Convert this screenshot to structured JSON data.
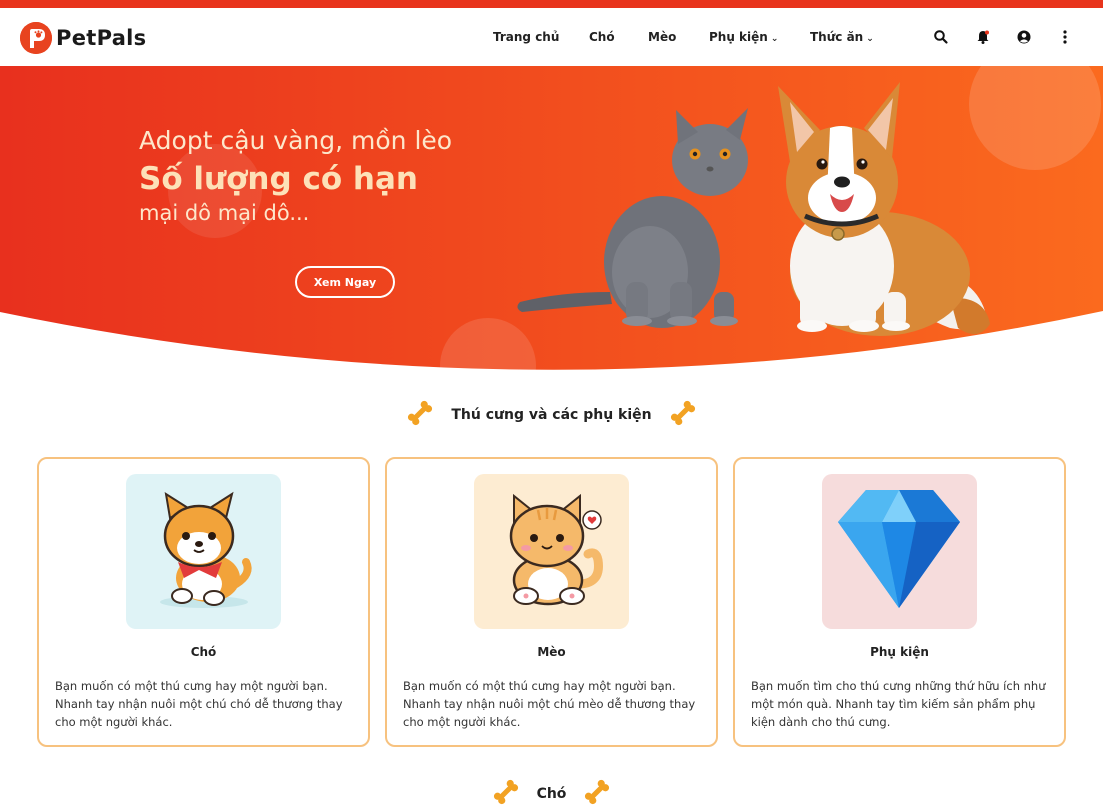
{
  "brand": {
    "name": "PetPals",
    "accent": "#e8341c",
    "hero_gradient": [
      "#e8301e",
      "#fb6a1e"
    ]
  },
  "nav": {
    "items": [
      {
        "label": "Trang chủ",
        "dropdown": false
      },
      {
        "label": "Chó",
        "dropdown": false
      },
      {
        "label": "Mèo",
        "dropdown": false
      },
      {
        "label": "Phụ kiện",
        "dropdown": true
      },
      {
        "label": "Thức ăn",
        "dropdown": true
      }
    ],
    "icons": [
      "search-icon",
      "bell-icon",
      "user-icon",
      "more-vertical-icon"
    ]
  },
  "hero": {
    "line1": "Adopt cậu vàng, mồn lèo",
    "line2": "Số lượng có hạn",
    "line3": "mại dô mại dô...",
    "button": "Xem Ngay"
  },
  "section_categories": {
    "title": "Thú cưng và các phụ kiện",
    "icon": "bone-icon"
  },
  "cards": [
    {
      "title": "Chó",
      "image": "dog-illustration",
      "bg": "#dff3f6",
      "description": "Bạn muốn có một thú cưng hay một người bạn. Nhanh tay nhận nuôi một chú chó dễ thương thay cho một người khác."
    },
    {
      "title": "Mèo",
      "image": "cat-illustration",
      "bg": "#fdecd2",
      "description": "Bạn muốn có một thú cưng hay một người bạn. Nhanh tay nhận nuôi một chú mèo dễ thương thay cho một người khác."
    },
    {
      "title": "Phụ kiện",
      "image": "diamond-illustration",
      "bg": "#f6dcdc",
      "description": "Bạn muốn tìm cho thú cưng những thứ hữu ích như một món quà. Nhanh tay tìm kiếm sản phẩm phụ kiện dành cho thú cưng."
    }
  ],
  "section_dogs": {
    "title": "Chó",
    "icon": "bone-icon"
  }
}
